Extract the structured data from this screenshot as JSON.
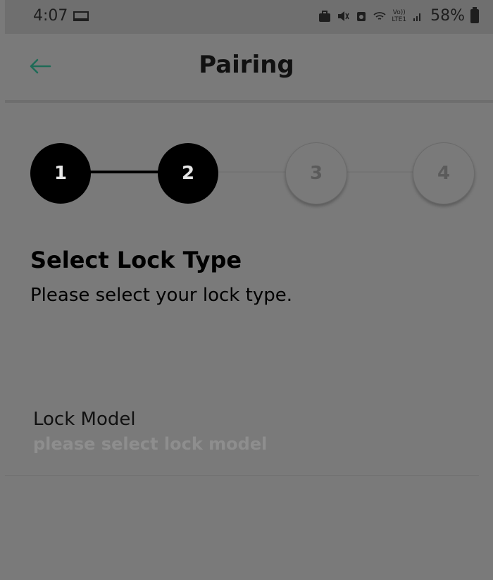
{
  "status_bar": {
    "time": "4:07",
    "battery": "58%",
    "icons": [
      "laptop-icon",
      "briefcase-icon",
      "mute-icon",
      "alarm-icon",
      "wifi-icon",
      "volte-icon",
      "signal-icon",
      "battery-icon"
    ],
    "volte_top": "Vo))",
    "volte_bottom": "LTE1"
  },
  "header": {
    "title": "Pairing",
    "back_icon": "arrow-left-icon",
    "accent": "#1f6b57"
  },
  "stepper": {
    "steps": [
      {
        "label": "1",
        "state": "done"
      },
      {
        "label": "2",
        "state": "current"
      },
      {
        "label": "3",
        "state": "pending"
      },
      {
        "label": "4",
        "state": "pending"
      }
    ]
  },
  "content": {
    "heading": "Select Lock Type",
    "subtitle": "Please select your lock type."
  },
  "field": {
    "label": "Lock Model",
    "placeholder": "please select lock model"
  }
}
